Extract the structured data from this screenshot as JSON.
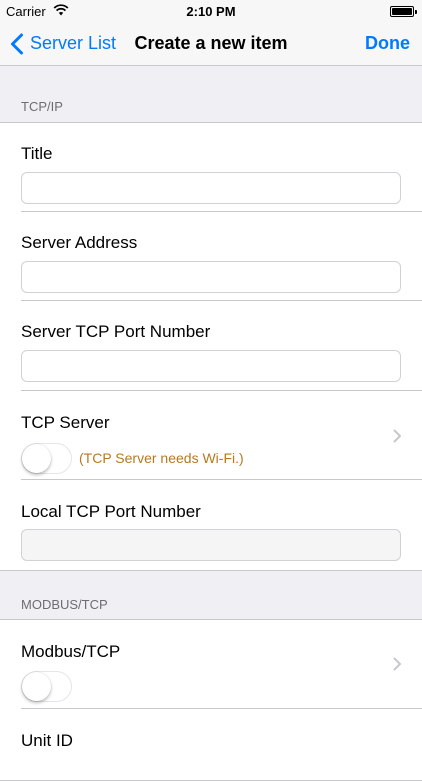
{
  "status_bar": {
    "carrier": "Carrier",
    "time": "2:10 PM",
    "battery_level": 1.0
  },
  "nav": {
    "back_label": "Server List",
    "title": "Create a new item",
    "done_label": "Done"
  },
  "sections": {
    "tcpip": {
      "header": "TCP/IP",
      "title_label": "Title",
      "title_value": "",
      "server_address_label": "Server Address",
      "server_address_value": "",
      "server_port_label": "Server TCP Port Number",
      "server_port_value": "",
      "tcp_server_label": "TCP Server",
      "tcp_server_enabled": false,
      "tcp_server_note": "(TCP Server needs Wi-Fi.)",
      "local_port_label": "Local TCP Port Number",
      "local_port_value": ""
    },
    "modbus": {
      "header": "MODBUS/TCP",
      "modbus_label": "Modbus/TCP",
      "modbus_enabled": false,
      "unit_id_label": "Unit ID"
    }
  },
  "colors": {
    "accent": "#007aff",
    "warning": "#b7791f",
    "background": "#efeff4"
  }
}
